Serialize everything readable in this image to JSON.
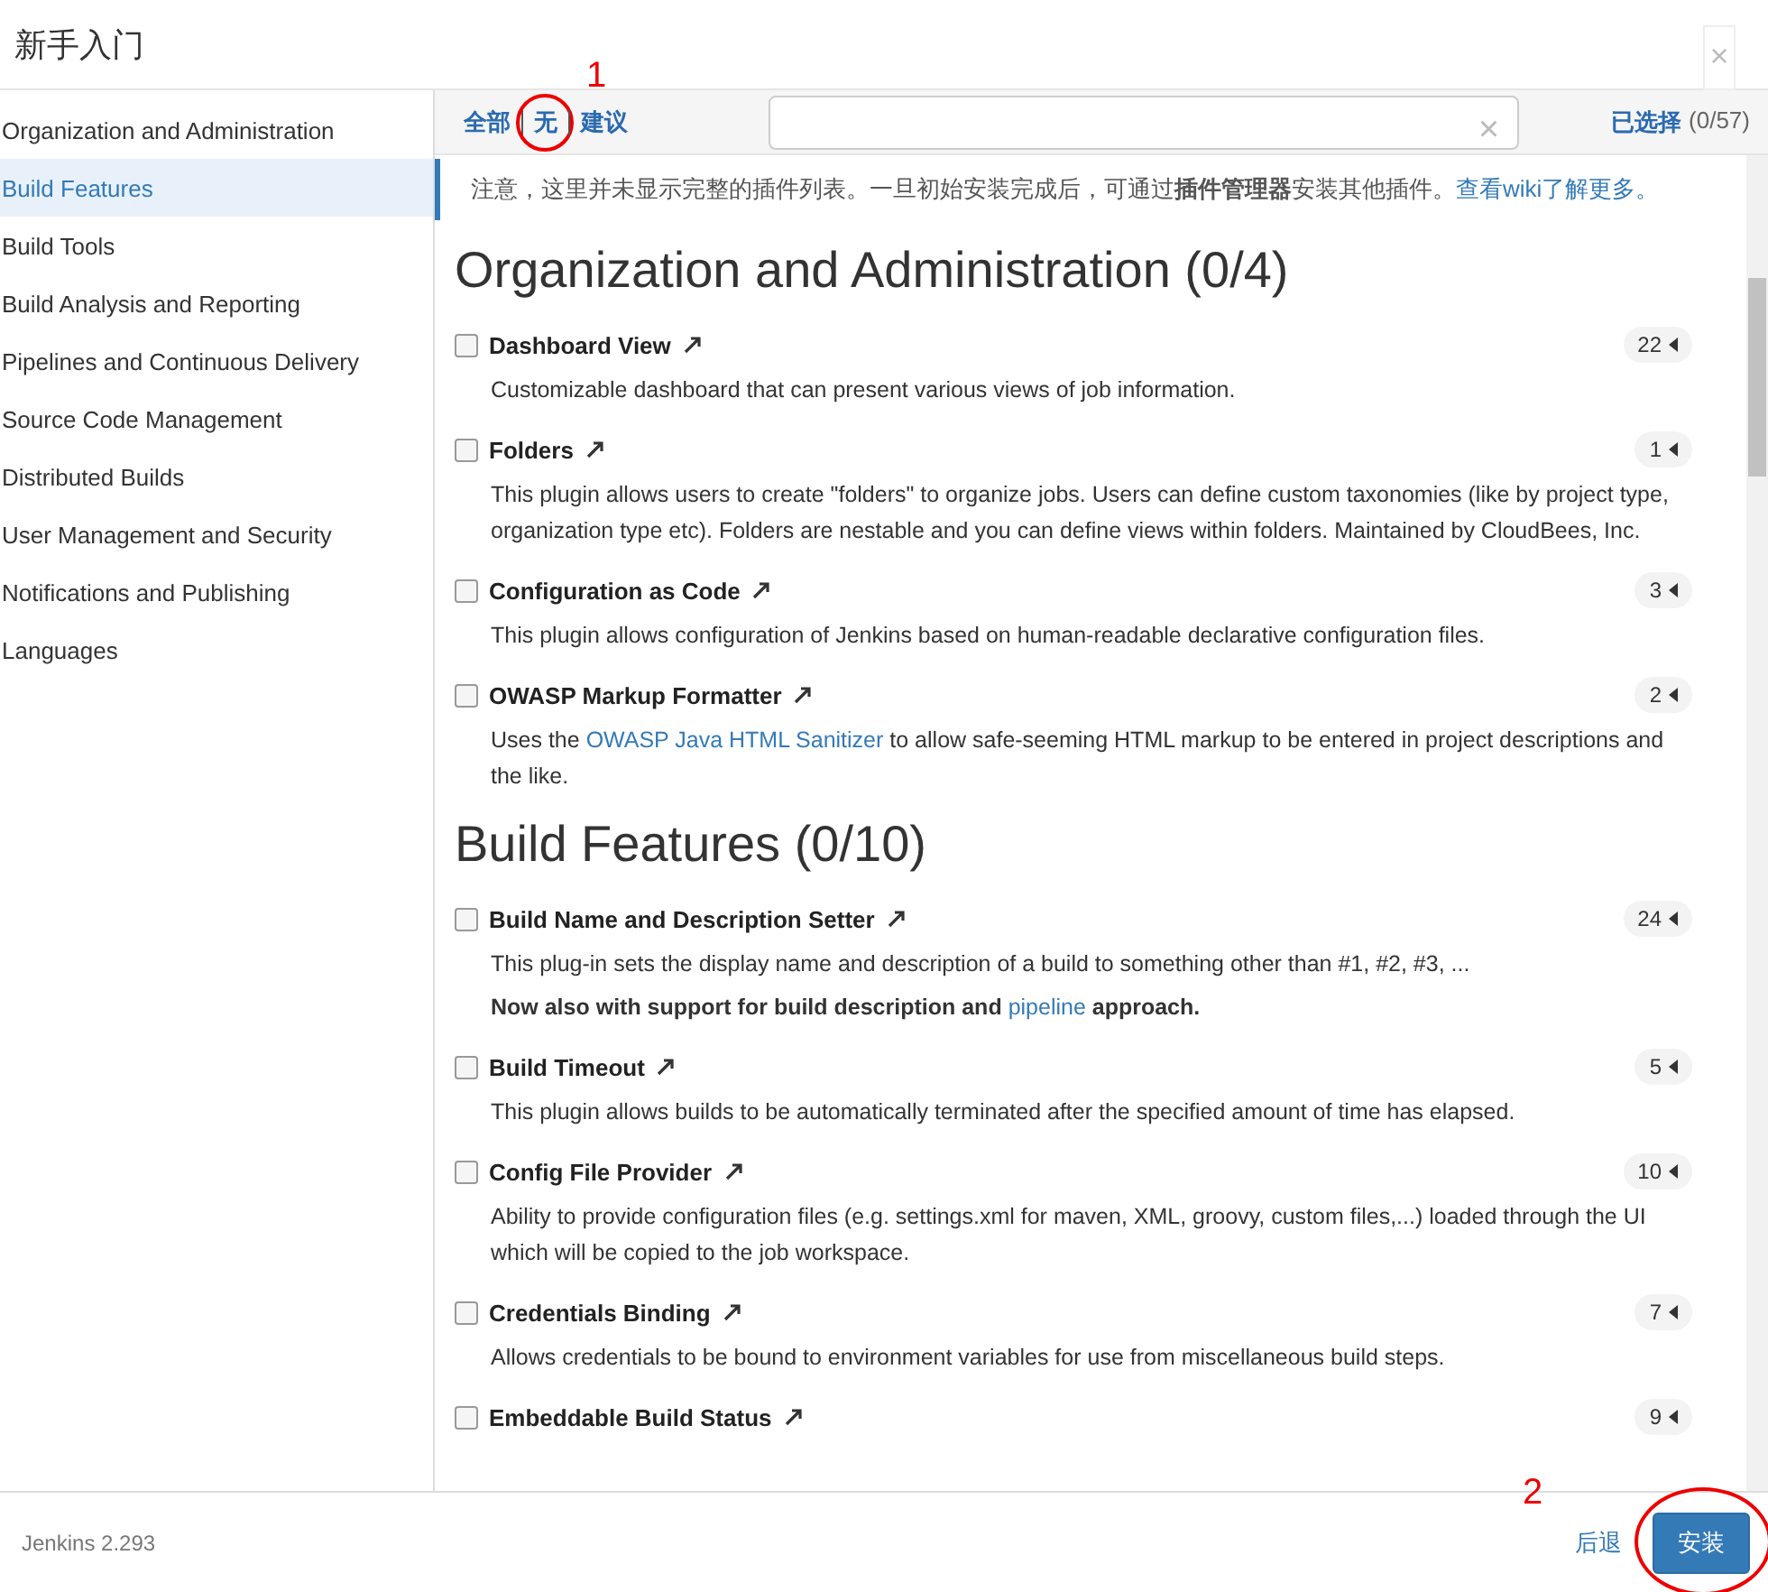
{
  "dialog": {
    "title": "新手入门",
    "close_label": "×"
  },
  "sidebar": {
    "items": [
      {
        "label": "Organization and Administration",
        "selected": false
      },
      {
        "label": "Build Features",
        "selected": true
      },
      {
        "label": "Build Tools",
        "selected": false
      },
      {
        "label": "Build Analysis and Reporting",
        "selected": false
      },
      {
        "label": "Pipelines and Continuous Delivery",
        "selected": false
      },
      {
        "label": "Source Code Management",
        "selected": false
      },
      {
        "label": "Distributed Builds",
        "selected": false
      },
      {
        "label": "User Management and Security",
        "selected": false
      },
      {
        "label": "Notifications and Publishing",
        "selected": false
      },
      {
        "label": "Languages",
        "selected": false
      }
    ]
  },
  "toolbar": {
    "filters": [
      {
        "label": "全部"
      },
      {
        "label": "无",
        "annotation": "1"
      },
      {
        "label": "建议"
      }
    ],
    "search": {
      "clear_label": "×"
    },
    "selected_label": "已选择",
    "selected_count": "(0/57)"
  },
  "notice": {
    "text": "注意，这里并未显示完整的插件列表。一旦初始安装完成后，可通过**插件管理器**安装其他插件。",
    "link": "查看wiki了解更多。"
  },
  "sections": [
    {
      "title": "Organization and Administration (0/4)",
      "plugins": [
        {
          "name": "Dashboard View",
          "count": "22",
          "checked": false,
          "description": [
            [
              {
                "text": "Customizable dashboard that can present various views of job information.",
                "link": false,
                "bold": false
              }
            ]
          ]
        },
        {
          "name": "Folders",
          "count": "1",
          "checked": false,
          "description": [
            [
              {
                "text": "This plugin allows users to create \"folders\" to organize jobs. Users can define custom taxonomies (like by project type, organization type etc). Folders are nestable and you can define views within folders. Maintained by CloudBees, Inc.",
                "link": false,
                "bold": false
              }
            ]
          ]
        },
        {
          "name": "Configuration as Code",
          "count": "3",
          "checked": false,
          "description": [
            [
              {
                "text": "This plugin allows configuration of Jenkins based on human-readable declarative configuration files.",
                "link": false,
                "bold": false
              }
            ]
          ]
        },
        {
          "name": "OWASP Markup Formatter",
          "count": "2",
          "checked": false,
          "description": [
            [
              {
                "text": "Uses the ",
                "link": false,
                "bold": false
              },
              {
                "text": "OWASP Java HTML Sanitizer",
                "link": true,
                "bold": false
              },
              {
                "text": " to allow safe-seeming HTML markup to be entered in project descriptions and the like.",
                "link": false,
                "bold": false
              }
            ]
          ]
        }
      ]
    },
    {
      "title": "Build Features (0/10)",
      "plugins": [
        {
          "name": "Build Name and Description Setter",
          "count": "24",
          "checked": false,
          "description": [
            [
              {
                "text": "This plug-in sets the display name and description of a build to something other than #1, #2, #3, ...",
                "link": false,
                "bold": false
              }
            ],
            [
              {
                "text": "Now also with support for build description and ",
                "link": false,
                "bold": true
              },
              {
                "text": "pipeline",
                "link": true,
                "bold": false
              },
              {
                "text": " approach.",
                "link": false,
                "bold": true
              }
            ]
          ]
        },
        {
          "name": "Build Timeout",
          "count": "5",
          "checked": false,
          "description": [
            [
              {
                "text": "This plugin allows builds to be automatically terminated after the specified amount of time has elapsed.",
                "link": false,
                "bold": false
              }
            ]
          ]
        },
        {
          "name": "Config File Provider",
          "count": "10",
          "checked": false,
          "description": [
            [
              {
                "text": "Ability to provide configuration files (e.g. settings.xml for maven, XML, groovy, custom files,...) loaded through the UI which will be copied to the job workspace.",
                "link": false,
                "bold": false
              }
            ]
          ]
        },
        {
          "name": "Credentials Binding",
          "count": "7",
          "checked": false,
          "description": [
            [
              {
                "text": "Allows credentials to be bound to environment variables for use from miscellaneous build steps.",
                "link": false,
                "bold": false
              }
            ]
          ]
        },
        {
          "name": "Embeddable Build Status",
          "count": "9",
          "checked": false
        }
      ]
    }
  ],
  "footer": {
    "version": "Jenkins 2.293",
    "back_label": "后退",
    "install_label": "安装",
    "install_annotation": "2"
  }
}
